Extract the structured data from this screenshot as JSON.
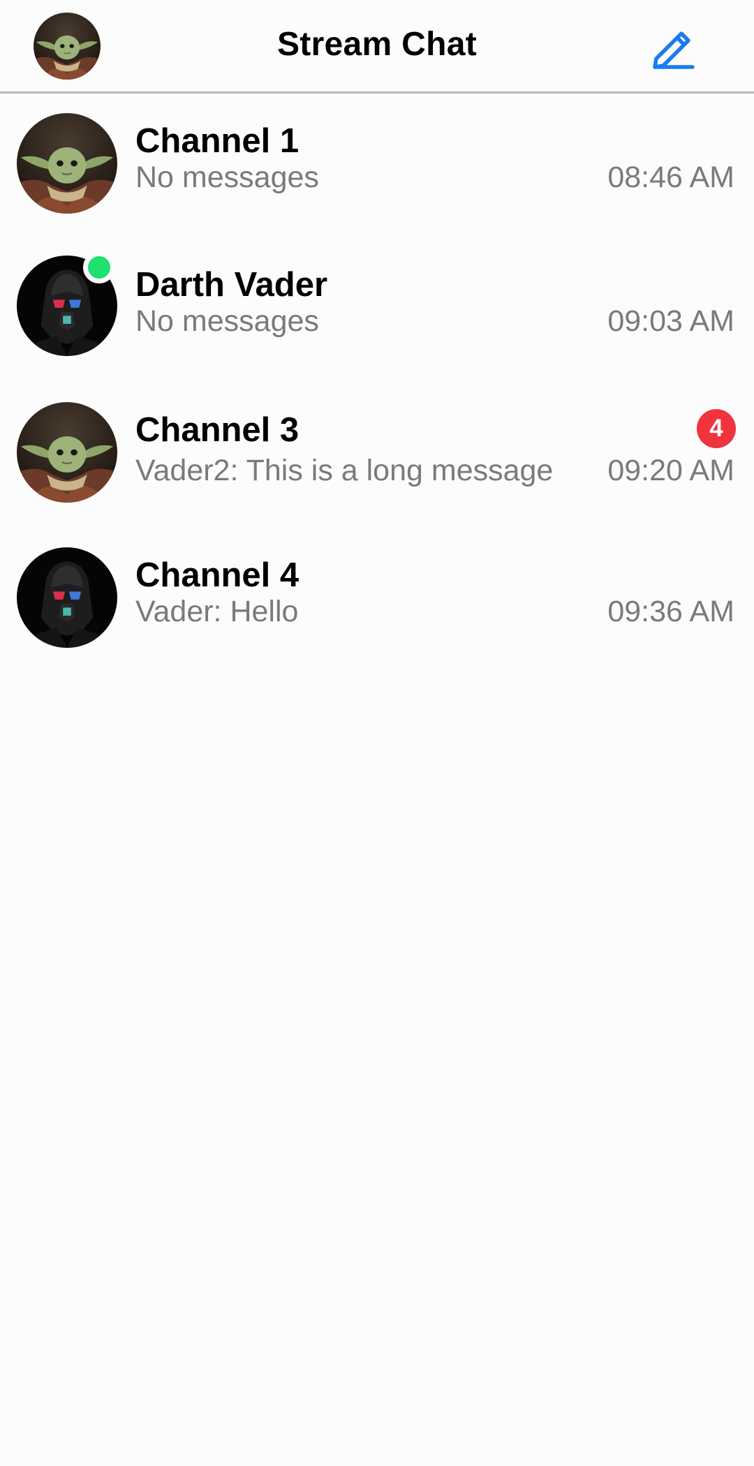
{
  "header": {
    "title": "Stream Chat",
    "avatar_icon": "baby-yoda-avatar",
    "compose_icon": "pencil-edit-icon",
    "accent_color": "#1b7bf0"
  },
  "channels": [
    {
      "name": "Channel 1",
      "preview": "No messages",
      "time": "08:46 AM",
      "avatar": "baby-yoda-avatar",
      "online": false,
      "unread": ""
    },
    {
      "name": "Darth Vader",
      "preview": "No messages",
      "time": "09:03 AM",
      "avatar": "darth-vader-avatar",
      "online": true,
      "unread": ""
    },
    {
      "name": "Channel 3",
      "preview": "Vader2: This is a long message",
      "time": "09:20 AM",
      "avatar": "baby-yoda-avatar",
      "online": false,
      "unread": "4"
    },
    {
      "name": "Channel 4",
      "preview": "Vader: Hello",
      "time": "09:36 AM",
      "avatar": "darth-vader-avatar",
      "online": false,
      "unread": ""
    }
  ],
  "colors": {
    "online": "#20e070",
    "badge": "#f0333d",
    "secondary_text": "#7a7a7a",
    "divider": "#b9b9b9"
  }
}
